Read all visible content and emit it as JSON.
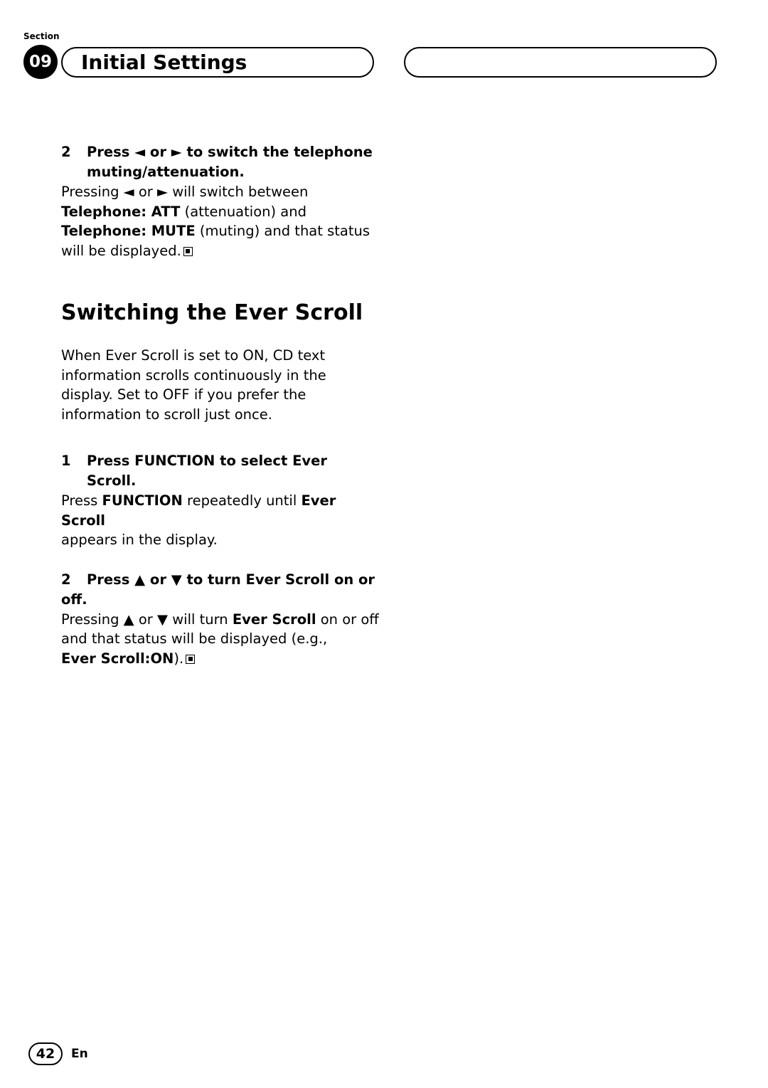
{
  "header": {
    "section_label": "Section",
    "section_number": "09",
    "title": "Initial Settings"
  },
  "content": {
    "step_a": {
      "number": "2",
      "heading_line1": "Press ◄ or ► to switch the telephone",
      "heading_line2": "muting/attenuation.",
      "body_1": "Pressing ◄ or ► will switch between",
      "body_bold_1": "Telephone: ATT",
      "body_2": " (attenuation) and",
      "body_bold_2": "Telephone: MUTE",
      "body_3": " (muting) and that status",
      "body_4": "will be displayed."
    },
    "heading": "Switching the Ever Scroll",
    "intro": "When Ever Scroll is set to ON, CD text information scrolls continuously in the display. Set to OFF if you prefer the information to scroll just once.",
    "step_b": {
      "number": "1",
      "heading": "Press FUNCTION to select Ever Scroll.",
      "body_1": "Press ",
      "body_bold_1": "FUNCTION",
      "body_2": " repeatedly until ",
      "body_bold_2": "Ever Scroll",
      "body_3": "appears in the display."
    },
    "step_c": {
      "number": "2",
      "heading_line1": "Press ▲ or ▼ to turn Ever Scroll on or",
      "heading_line2": "off.",
      "body_1": "Pressing ▲ or ▼ will turn ",
      "body_bold_1": "Ever Scroll",
      "body_2": " on or off",
      "body_3": "and that status will be displayed (e.g.,",
      "body_bold_3": "Ever Scroll:ON",
      "body_4": ")."
    }
  },
  "footer": {
    "page_number": "42",
    "language": "En"
  }
}
